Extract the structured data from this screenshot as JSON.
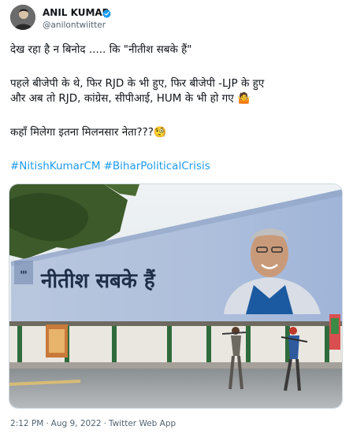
{
  "author": {
    "name": "ANIL KUMAR",
    "handle": "@anilontwiitter"
  },
  "tweet": {
    "line1": "देख रहा है न बिनोद ..... कि  \"नीतीश सबके हैं\"",
    "line2": "पहले बीजेपी के थे, फिर RJD के भी हुए, फिर बीजेपी -LJP के हुए",
    "line3": "और अब तो RJD, कांग्रेस, सीपीआई, HUM के भी हो गए 🤷",
    "line4": "कहाँ मिलेगा इतना मिलनसार नेता???🧐",
    "hashtags": [
      "#NitishKumarCM",
      "#BiharPoliticalCrisis"
    ]
  },
  "image": {
    "billboard_text": "नीतीश सबके हैं"
  },
  "footer": {
    "time": "2:12 PM",
    "date": "Aug 9, 2022",
    "source": "Twitter Web App"
  },
  "colors": {
    "link": "#1d9bf0",
    "verified": "#1d9bf0",
    "secondary_text": "#536471"
  }
}
